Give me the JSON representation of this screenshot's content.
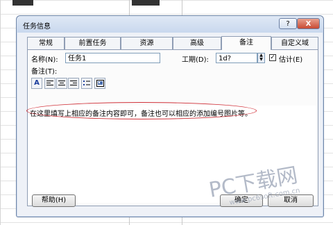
{
  "dialog": {
    "title": "任务信息",
    "help_icon": "?",
    "close_icon": "X"
  },
  "tabs": [
    {
      "label": "常规"
    },
    {
      "label": "前置任务"
    },
    {
      "label": "资源"
    },
    {
      "label": "高级"
    },
    {
      "label": "备注",
      "selected": true
    },
    {
      "label": "自定义域"
    }
  ],
  "form": {
    "name_label": "名称(N):",
    "name_value": "任务1",
    "duration_label": "工期(D):",
    "duration_value": "1d?",
    "estimated_label": "估计(E)",
    "estimated_checked": true,
    "estimated_mark": "✓",
    "notes_label": "备注(T):",
    "notes_text": "在这里填写上相应的备注内容即可，备注也可以相应的添加编号图片等。"
  },
  "notes_toolbar": [
    {
      "icon": "font-icon",
      "glyph": "A"
    },
    {
      "icon": "align-left-icon"
    },
    {
      "icon": "align-center-icon"
    },
    {
      "icon": "align-right-icon"
    },
    {
      "icon": "bullet-list-icon"
    },
    {
      "icon": "insert-object-icon"
    }
  ],
  "buttons": {
    "help": "帮助(H)",
    "ok": "确定",
    "cancel": "取消"
  },
  "watermark": {
    "big": "PC下载网",
    "url": "www.pc6soft.com.cn"
  },
  "colors": {
    "annotation_oval": "#d1323a",
    "title_bar": "#c9d8ee",
    "close_button": "#c84a33"
  }
}
